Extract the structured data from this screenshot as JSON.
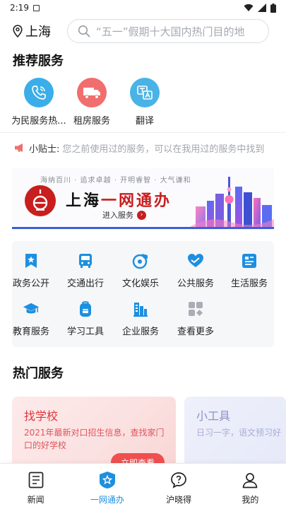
{
  "status_bar": {
    "time": "2:19"
  },
  "header": {
    "location": "上海",
    "search_placeholder": "“五一”假期十大国内热门目的地"
  },
  "recommended": {
    "title": "推荐服务",
    "items": [
      {
        "label": "为民服务热...",
        "icon": "phone-icon",
        "color": "#3aaee8"
      },
      {
        "label": "租房服务",
        "icon": "truck-icon",
        "color": "#f06e6e"
      },
      {
        "label": "翻译",
        "icon": "translate-icon",
        "color": "#4ab3e6"
      }
    ]
  },
  "tip": {
    "label": "小贴士:",
    "text": "您之前使用过的服务，可以在我用过的服务中找到"
  },
  "banner": {
    "tagline": "海纳百川 · 追求卓越 · 开明睿智 · 大气谦和",
    "title_part1": "上海",
    "title_part2": "一网通办",
    "subtitle": "进入服务"
  },
  "categories": [
    {
      "label": "政务公开",
      "icon": "bookmark-star-icon"
    },
    {
      "label": "交通出行",
      "icon": "bus-icon"
    },
    {
      "label": "文化娱乐",
      "icon": "music-disc-icon"
    },
    {
      "label": "公共服务",
      "icon": "heart-hands-icon"
    },
    {
      "label": "生活服务",
      "icon": "receipt-icon"
    },
    {
      "label": "教育服务",
      "icon": "graduation-cap-icon"
    },
    {
      "label": "学习工具",
      "icon": "backpack-icon"
    },
    {
      "label": "企业服务",
      "icon": "building-icon"
    },
    {
      "label": "查看更多",
      "icon": "grid-more-icon"
    }
  ],
  "hot": {
    "title": "热门服务",
    "cards": [
      {
        "title": "找学校",
        "desc": "2021年最新对口招生信息，查找家门口的好学校",
        "button": "立即查看"
      },
      {
        "title": "小工具",
        "desc": "日习一字，语文预习好"
      }
    ]
  },
  "bottom_nav": [
    {
      "label": "新闻",
      "icon": "news-icon",
      "active": false
    },
    {
      "label": "一网通办",
      "icon": "service-star-icon",
      "active": true
    },
    {
      "label": "沪晓得",
      "icon": "question-bubble-icon",
      "active": false
    },
    {
      "label": "我的",
      "icon": "person-icon",
      "active": false
    }
  ],
  "colors": {
    "accent": "#1d8fe0",
    "brand_red": "#c81e1e",
    "icon_blue": "#1d8fe0"
  }
}
